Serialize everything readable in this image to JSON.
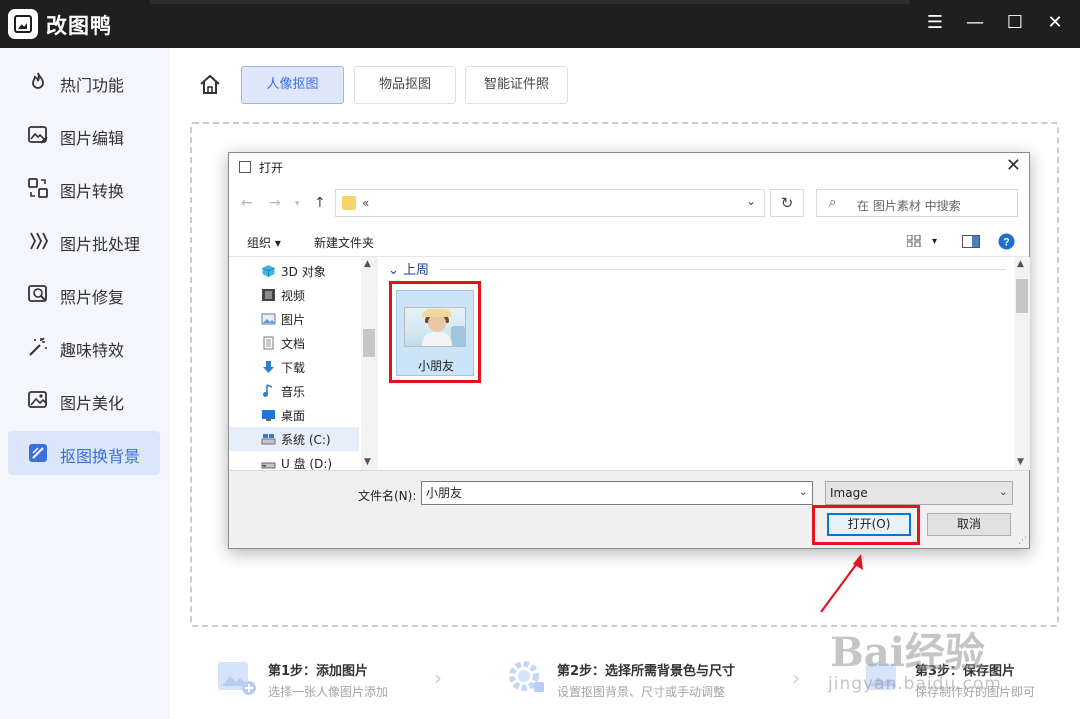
{
  "app": {
    "title": "改图鸭",
    "window_controls": [
      "menu-icon",
      "minimize-icon",
      "maximize-icon",
      "close-icon"
    ]
  },
  "sidebar": {
    "items": [
      {
        "label": "热门功能",
        "icon": "flame-icon"
      },
      {
        "label": "图片编辑",
        "icon": "image-edit-icon"
      },
      {
        "label": "图片转换",
        "icon": "convert-icon"
      },
      {
        "label": "图片批处理",
        "icon": "batch-icon"
      },
      {
        "label": "照片修复",
        "icon": "photo-repair-icon"
      },
      {
        "label": "趣味特效",
        "icon": "magic-wand-icon"
      },
      {
        "label": "图片美化",
        "icon": "beautify-icon"
      },
      {
        "label": "抠图换背景",
        "icon": "cutout-icon",
        "active": true
      }
    ]
  },
  "main": {
    "tabs": [
      {
        "label": "人像抠图",
        "active": true
      },
      {
        "label": "物品抠图"
      },
      {
        "label": "智能证件照"
      }
    ],
    "steps": [
      {
        "title": "第1步：添加图片",
        "subtitle": "选择一张人像图片添加"
      },
      {
        "title": "第2步：选择所需背景色与尺寸",
        "subtitle": "设置抠图背景、尺寸或手动调整"
      },
      {
        "title": "第3步：保存图片",
        "subtitle": "保存制作好的图片即可"
      }
    ]
  },
  "dialog": {
    "title": "打开",
    "address": "«",
    "search_placeholder": "在 图片素材 中搜索",
    "toolbar": {
      "organize": "组织 ▾",
      "new_folder": "新建文件夹"
    },
    "tree": [
      {
        "label": "3D 对象",
        "icon": "cube-3d-icon"
      },
      {
        "label": "视频",
        "icon": "video-icon"
      },
      {
        "label": "图片",
        "icon": "pictures-icon"
      },
      {
        "label": "文档",
        "icon": "document-icon"
      },
      {
        "label": "下载",
        "icon": "download-icon"
      },
      {
        "label": "音乐",
        "icon": "music-icon"
      },
      {
        "label": "桌面",
        "icon": "desktop-icon"
      },
      {
        "label": "系统 (C:)",
        "icon": "drive-icon",
        "selected": true
      },
      {
        "label": "U 盘 (D:)",
        "icon": "usb-drive-icon"
      }
    ],
    "group_header": "上周",
    "files": [
      {
        "name": "小朋友",
        "selected": true
      }
    ],
    "filename_label": "文件名(N):",
    "filename_value": "小朋友",
    "filetype": "Image",
    "open_button": "打开(O)",
    "cancel_button": "取消"
  },
  "watermark": {
    "big": "Bai经验",
    "small": "jingyan.baidu.com"
  },
  "colors": {
    "accent": "#3a6fe0",
    "highlight": "#e3141b",
    "titlebar": "#1f1f1f"
  }
}
